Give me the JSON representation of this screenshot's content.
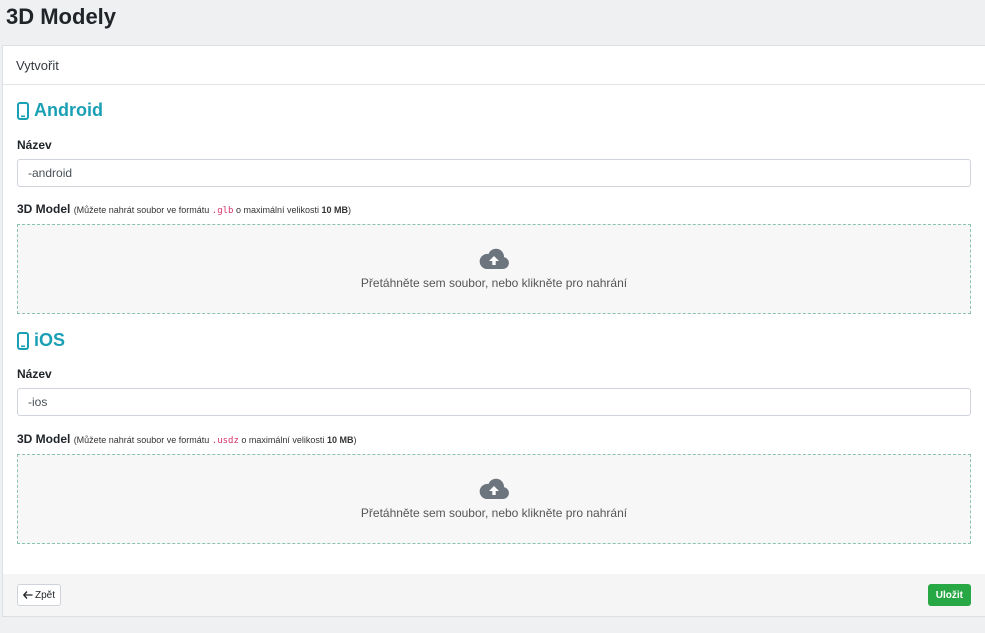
{
  "page": {
    "title": "3D Modely"
  },
  "card": {
    "header": "Vytvořit"
  },
  "sections": [
    {
      "title": "Android",
      "name_label": "Název",
      "name_value": "-android",
      "model_label": "3D Model",
      "hint_prefix": "(Můžete nahrát soubor ve formátu",
      "hint_format": ".glb",
      "hint_middle": "o maximální velikosti",
      "hint_size": "10 MB",
      "hint_suffix": ")",
      "dropzone_text": "Přetáhněte sem soubor, nebo klikněte pro nahrání"
    },
    {
      "title": "iOS",
      "name_label": "Název",
      "name_value": "-ios",
      "model_label": "3D Model",
      "hint_prefix": "(Můžete nahrát soubor ve formátu",
      "hint_format": ".usdz",
      "hint_middle": "o maximální velikosti",
      "hint_size": "10 MB",
      "hint_suffix": ")",
      "dropzone_text": "Přetáhněte sem soubor, nebo klikněte pro nahrání"
    }
  ],
  "footer": {
    "back_label": "Zpět",
    "save_label": "Uložit"
  },
  "colors": {
    "accent": "#1aa0b4",
    "success": "#28a745",
    "code": "#d6336c"
  },
  "icons": {
    "section": "mobile-phone-icon",
    "upload": "cloud-upload-icon",
    "back": "arrow-left-icon"
  }
}
